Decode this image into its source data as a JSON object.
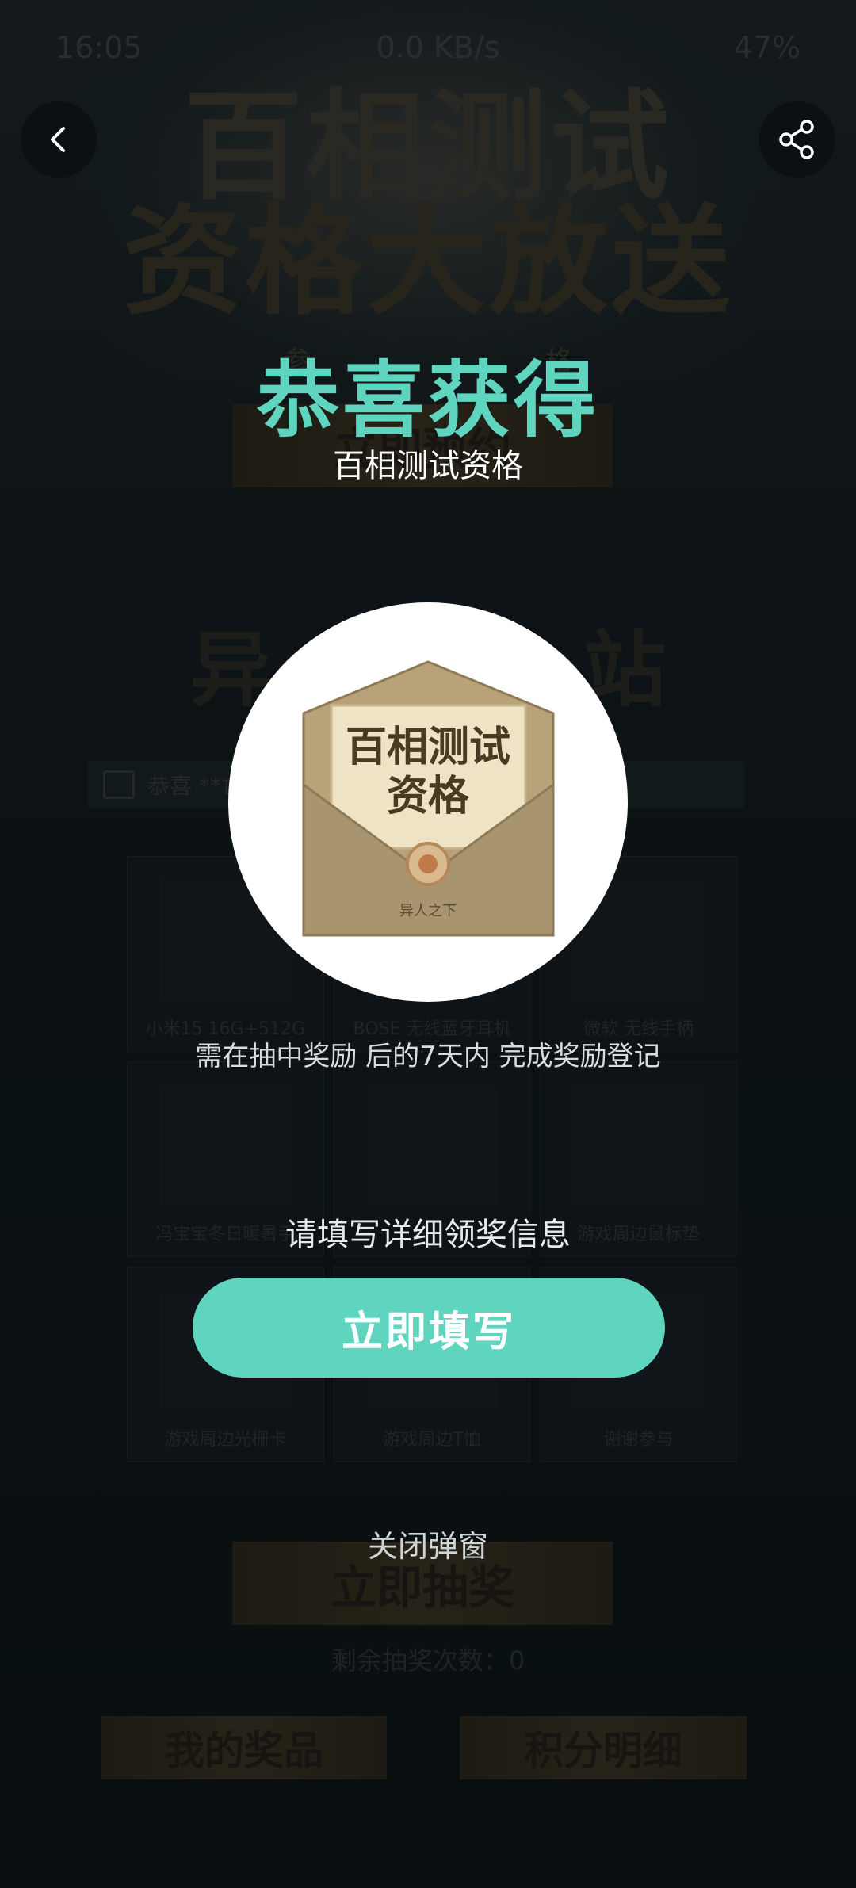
{
  "status_bar": {
    "time": "16:05",
    "net": "0.0 KB/s",
    "battery": "47%"
  },
  "background": {
    "hero_line1": "百相测试",
    "hero_line2": "资格大放送",
    "sub_left": "参",
    "sub_right": "格",
    "reserve_button": "立即预约",
    "section_title": "异",
    "section_title_right": "站",
    "ticker_text": "恭喜 **亡",
    "grid": [
      {
        "label": "小米15 16G+512G"
      },
      {
        "label": "BOSE 无线蓝牙耳机"
      },
      {
        "label": "微软 无线手柄"
      },
      {
        "label": "冯宝宝冬日暖暑手"
      },
      {
        "label": ""
      },
      {
        "label": "游戏周边鼠标垫"
      },
      {
        "label": "游戏周边光栅卡"
      },
      {
        "label": "游戏周边T恤"
      },
      {
        "label": "谢谢参与"
      }
    ],
    "draw_button": "立即抽奖",
    "remaining_draws": "剩余抽奖次数：0",
    "my_prizes_button": "我的奖品",
    "points_detail_button": "积分明细"
  },
  "modal": {
    "congrats_title": "恭喜获得",
    "prize_name": "百相测试资格",
    "prize_image_text_line1": "百相测试",
    "prize_image_text_line2": "资格",
    "prize_image_footer": "异人之下",
    "notice": "需在抽中奖励 后的7天内 完成奖励登记",
    "fill_hint": "请填写详细领奖信息",
    "fill_button": "立即填写",
    "close_link": "关闭弹窗"
  },
  "colors": {
    "accent": "#5fd4bf",
    "envelope": "#b7a27a",
    "card": "#efe3c6"
  },
  "icons": {
    "back": "chevron-left-icon",
    "share": "share-icon"
  }
}
